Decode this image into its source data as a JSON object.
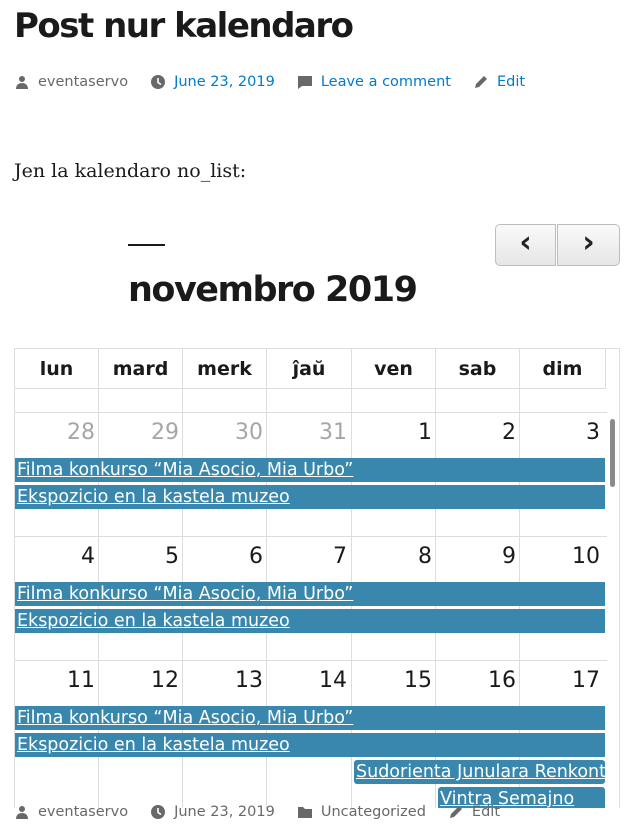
{
  "post": {
    "title": "Post nur kalendaro",
    "top_meta": {
      "author": "eventaservo",
      "date": "June 23, 2019",
      "comment": "Leave a comment",
      "edit": "Edit"
    },
    "intro": "Jen la kalendaro no_list:"
  },
  "calendar": {
    "prev_label": "‹",
    "next_label": "›",
    "month_title": "novembro 2019",
    "weekdays": [
      "lun",
      "mard",
      "merk",
      "ĵaŭ",
      "ven",
      "sab",
      "dim"
    ],
    "weeks": [
      {
        "days": [
          {
            "n": "28",
            "other": true
          },
          {
            "n": "29",
            "other": true
          },
          {
            "n": "30",
            "other": true
          },
          {
            "n": "31",
            "other": true
          },
          {
            "n": "1",
            "other": false
          },
          {
            "n": "2",
            "other": false
          },
          {
            "n": "3",
            "other": false
          }
        ],
        "events": [
          {
            "title": "Filma konkurso “Mia Asocio, Mia Urbo”",
            "start": 0,
            "end": 6
          },
          {
            "title": "Ekspozicio en la kastela muzeo",
            "start": 0,
            "end": 6
          }
        ]
      },
      {
        "days": [
          {
            "n": "4",
            "other": false
          },
          {
            "n": "5",
            "other": false
          },
          {
            "n": "6",
            "other": false
          },
          {
            "n": "7",
            "other": false
          },
          {
            "n": "8",
            "other": false
          },
          {
            "n": "9",
            "other": false
          },
          {
            "n": "10",
            "other": false
          }
        ],
        "events": [
          {
            "title": "Filma konkurso “Mia Asocio, Mia Urbo”",
            "start": 0,
            "end": 6
          },
          {
            "title": "Ekspozicio en la kastela muzeo",
            "start": 0,
            "end": 6
          }
        ]
      },
      {
        "days": [
          {
            "n": "11",
            "other": false
          },
          {
            "n": "12",
            "other": false
          },
          {
            "n": "13",
            "other": false
          },
          {
            "n": "14",
            "other": false
          },
          {
            "n": "15",
            "other": false
          },
          {
            "n": "16",
            "other": false
          },
          {
            "n": "17",
            "other": false
          }
        ],
        "events": [
          {
            "title": "Filma konkurso “Mia Asocio, Mia Urbo”",
            "start": 0,
            "end": 6
          },
          {
            "title": "Ekspozicio en la kastela muzeo",
            "start": 0,
            "end": 6
          },
          {
            "title": "Sudorienta Junulara Renkontiĝo",
            "start": 4,
            "end": 6
          },
          {
            "title": "Vintra Semajno",
            "start": 5,
            "end": 6
          }
        ]
      }
    ]
  },
  "bottom_meta": {
    "author": "eventaservo",
    "date": "June 23, 2019",
    "category": "Uncategorized",
    "edit": "Edit"
  },
  "colors": {
    "event_bg": "#3a87ad",
    "link": "#007acc",
    "meta": "#686868",
    "other_month": "#a6a6a6"
  }
}
